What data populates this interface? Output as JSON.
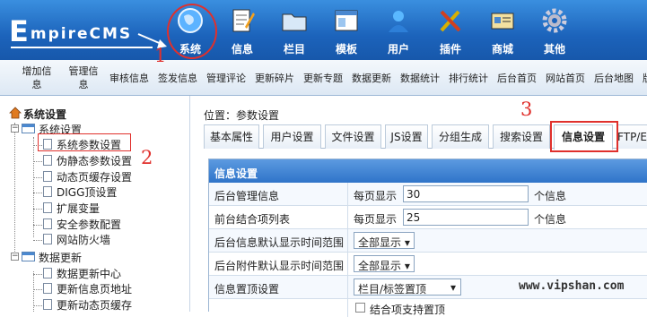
{
  "app": {
    "logo": "mpireCMS",
    "logo_initial": "E"
  },
  "nav": [
    {
      "label": "系统",
      "icon": "globe-icon"
    },
    {
      "label": "信息",
      "icon": "notepad-icon"
    },
    {
      "label": "栏目",
      "icon": "folder-icon"
    },
    {
      "label": "模板",
      "icon": "window-icon"
    },
    {
      "label": "用户",
      "icon": "user-icon"
    },
    {
      "label": "插件",
      "icon": "tools-icon"
    },
    {
      "label": "商城",
      "icon": "card-icon"
    },
    {
      "label": "其他",
      "icon": "gear-icon"
    }
  ],
  "subnav": {
    "add_info": "增加信息",
    "manage_info": "管理信息",
    "items": [
      "审核信息",
      "签发信息",
      "管理评论",
      "更新碎片",
      "更新专题",
      "数据更新",
      "数据统计",
      "排行统计",
      "后台首页",
      "网站首页",
      "后台地图"
    ],
    "cut_char": "版"
  },
  "sidebar": {
    "title": "系统设置",
    "items": [
      "系统设置",
      "系统参数设置",
      "伪静态参数设置",
      "动态页缓存设置",
      "DIGG顶设置",
      "扩展变量",
      "安全参数配置",
      "网站防火墙",
      "数据更新",
      "数据更新中心",
      "更新信息页地址",
      "更新动态页缓存"
    ]
  },
  "main": {
    "breadcrumb": "位置：参数设置",
    "tabs": [
      "基本属性",
      "用户设置",
      "文件设置",
      "JS设置",
      "分组生成",
      "搜索设置",
      "信息设置",
      "FTP/E"
    ],
    "form": {
      "header": "信息设置",
      "rows": [
        {
          "label": "后台管理信息",
          "pre": "每页显示",
          "value": "30",
          "post": "个信息"
        },
        {
          "label": "前台结合项列表",
          "pre": "每页显示",
          "value": "25",
          "post": "个信息"
        },
        {
          "label": "后台信息默认显示时间范围",
          "select": "全部显示"
        },
        {
          "label": "后台附件默认显示时间范围",
          "select": "全部显示"
        },
        {
          "label": "信息置顶设置",
          "select": "栏目/标签置顶"
        }
      ],
      "last_row_partial": "结合项支持置顶"
    }
  },
  "annotations": [
    "1",
    "2",
    "3"
  ],
  "watermark": "www.vipshan.com",
  "colors": {
    "topbar": "#1c63bb",
    "accent": "#e0302c",
    "form_header": "#2f74c9"
  }
}
